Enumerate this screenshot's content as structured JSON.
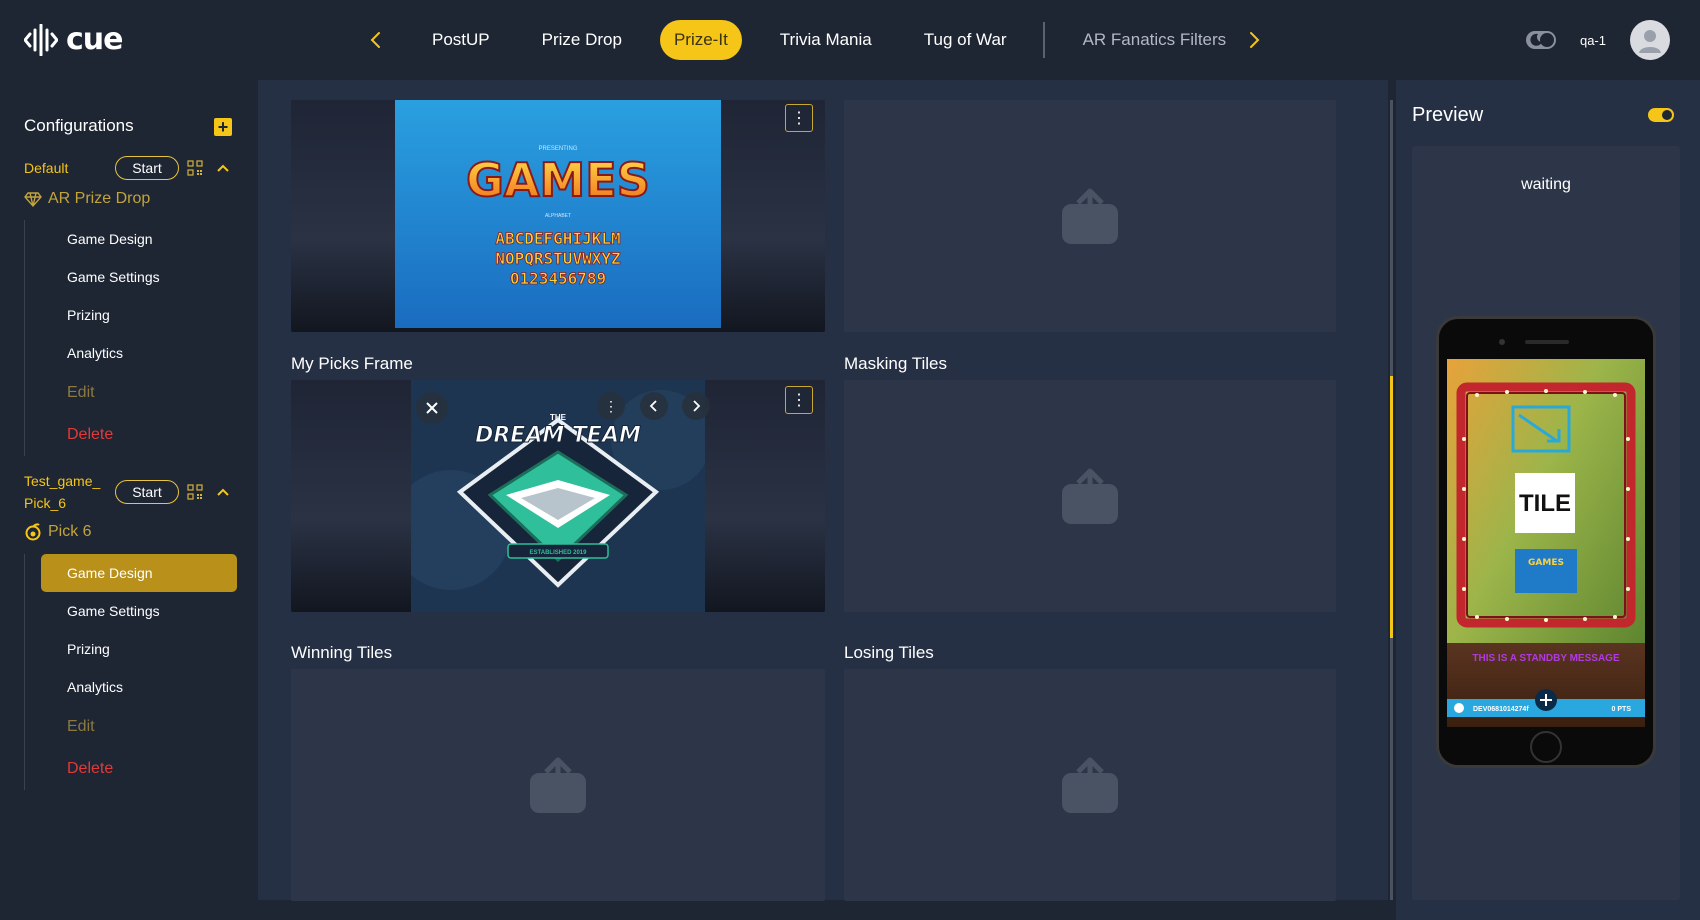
{
  "app": {
    "logo_text": "cue"
  },
  "header": {
    "tabs": [
      {
        "label": "PostUP",
        "state": "normal"
      },
      {
        "label": "Prize Drop",
        "state": "normal"
      },
      {
        "label": "Prize-It",
        "state": "active"
      },
      {
        "label": "Trivia Mania",
        "state": "normal"
      },
      {
        "label": "Tug of War",
        "state": "normal"
      },
      {
        "label": "AR Fanatics Filters",
        "state": "dim"
      }
    ],
    "user": "qa-1"
  },
  "sidebar": {
    "title": "Configurations",
    "configs": [
      {
        "name": "Default",
        "start_label": "Start",
        "game_type": "AR Prize Drop",
        "items": [
          "Game Design",
          "Game Settings",
          "Prizing",
          "Analytics"
        ],
        "edit_label": "Edit",
        "delete_label": "Delete"
      },
      {
        "name_line1": "Test_game_",
        "name_line2": "Pick_6",
        "start_label": "Start",
        "game_type": "Pick 6",
        "items": [
          "Game Design",
          "Game Settings",
          "Prizing",
          "Analytics"
        ],
        "selected_item": "Game Design",
        "edit_label": "Edit",
        "delete_label": "Delete"
      }
    ]
  },
  "main": {
    "sections": {
      "my_picks_frame": "My Picks Frame",
      "masking_tiles": "Masking Tiles",
      "winning_tiles": "Winning Tiles",
      "losing_tiles": "Losing Tiles"
    },
    "games_image": {
      "presenting": "PRESENTING",
      "title": "GAMES",
      "subtitle": "ALPHABET",
      "row1": "ABCDEFGHIJKLM",
      "row2": "NOPQRSTUVWXYZ",
      "row3": "0123456789"
    },
    "dream_team_image": {
      "the": "THE",
      "title": "DREAM TEAM",
      "est": "ESTABLISHED 2019"
    }
  },
  "preview": {
    "title": "Preview",
    "status": "waiting",
    "phone": {
      "tile_text": "TILE",
      "mini_games": "GAMES",
      "standby_message": "THIS IS A STANDBY MESSAGE",
      "device_id": "DEV0681014274f",
      "points": "0 PTS"
    }
  },
  "colors": {
    "accent": "#f5c518",
    "background": "#1e2533",
    "panel": "#263044",
    "tile": "#2d3649",
    "danger": "#e03a3a"
  }
}
